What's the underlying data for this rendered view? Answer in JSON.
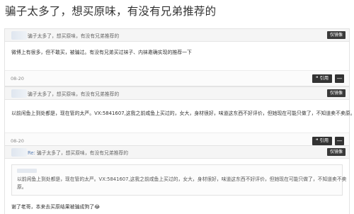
{
  "thread_title": "骗子太多了，想买原味，有没有兄弟推荐的",
  "report_label": "仅镜像",
  "quote_label": "引用",
  "more_label": "—",
  "posts": [
    {
      "header": "骗子太多了，想买原味，有没有兄弟推荐的",
      "body": "微博上有很多，但不敢买，被骗过。有没有兄弟买过袜子、内袜邀确实现的推荐一下",
      "date": "08-20"
    },
    {
      "header": "骗子太多了，想买原味，有没有兄弟推荐的",
      "body": "以前闲鱼上到处都是，现在管的太严。VX:5841607,这我之前咸鱼上买过的，女大，身材很好，味道这东西不好评价，但她现在可能只做了，不知道卖不卖原。",
      "date": "08-20"
    },
    {
      "re_prefix": "Re:",
      "header": "骗子太多了，想买原味，有没有兄弟推荐的",
      "quote_line1": "以前闲鱼上到处都是，现在管的太严。VX:5841607,这我之前咸鱼上买过的，女大，身材很好，味道这东西不好评价，但她现在可能只做了，不知道卖不卖",
      "quote_line2": "原。",
      "body": "谢了老哥，本来去买原结果被骗成狗了😂"
    }
  ]
}
